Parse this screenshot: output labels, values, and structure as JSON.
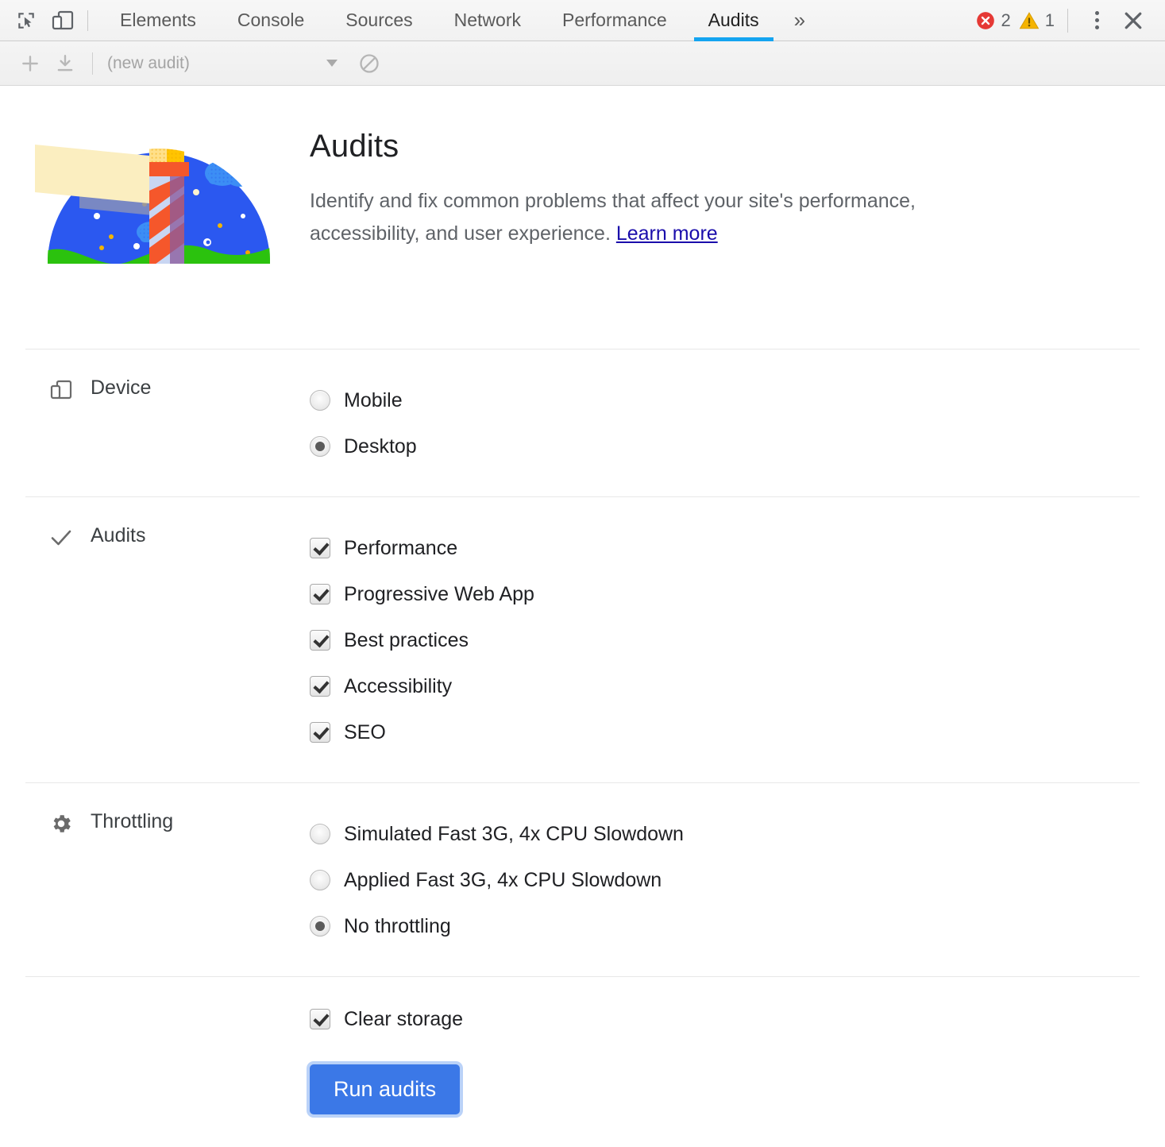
{
  "window": {
    "app": "Chrome DevTools"
  },
  "tabbar": {
    "inspect_icon": "inspect-element-icon",
    "device_toolbar_icon": "device-toolbar-icon",
    "tabs": [
      {
        "label": "Elements",
        "active": false
      },
      {
        "label": "Console",
        "active": false
      },
      {
        "label": "Sources",
        "active": false
      },
      {
        "label": "Network",
        "active": false
      },
      {
        "label": "Performance",
        "active": false
      },
      {
        "label": "Audits",
        "active": true
      }
    ],
    "more_tabs_label": "»",
    "errors": {
      "icon": "error-icon",
      "count": "2",
      "color": "#e53935"
    },
    "warnings": {
      "icon": "warning-icon",
      "count": "1",
      "color": "#f5b400"
    },
    "menu_icon": "kebab-menu-icon",
    "close_icon": "close-icon",
    "active_underline_color": "#14a4f0"
  },
  "subtoolbar": {
    "add_label": "+",
    "add_icon": "add-icon",
    "import_icon": "import-download-icon",
    "audit_select_value": "(new audit)",
    "caret_icon": "chevron-down-icon",
    "clear_icon": "clear-no-entry-icon"
  },
  "hero": {
    "illustration": "lighthouse-illustration",
    "title": "Audits",
    "description_part1": "Identify and fix common problems that affect your site's performance, accessibility, and user experience. ",
    "learn_more": "Learn more"
  },
  "device_section": {
    "icon": "device-icon",
    "label": "Device",
    "options": [
      {
        "label": "Mobile",
        "selected": false
      },
      {
        "label": "Desktop",
        "selected": true
      }
    ]
  },
  "audits_section": {
    "icon": "checkmark-icon",
    "label": "Audits",
    "options": [
      {
        "label": "Performance",
        "checked": true
      },
      {
        "label": "Progressive Web App",
        "checked": true
      },
      {
        "label": "Best practices",
        "checked": true
      },
      {
        "label": "Accessibility",
        "checked": true
      },
      {
        "label": "SEO",
        "checked": true
      }
    ]
  },
  "throttling_section": {
    "icon": "gear-icon",
    "label": "Throttling",
    "options": [
      {
        "label": "Simulated Fast 3G, 4x CPU Slowdown",
        "selected": false
      },
      {
        "label": "Applied Fast 3G, 4x CPU Slowdown",
        "selected": false
      },
      {
        "label": "No throttling",
        "selected": true
      }
    ]
  },
  "footer": {
    "clear_storage": {
      "label": "Clear storage",
      "checked": true
    },
    "run_button": {
      "label": "Run audits",
      "color": "#3b78e7"
    }
  }
}
